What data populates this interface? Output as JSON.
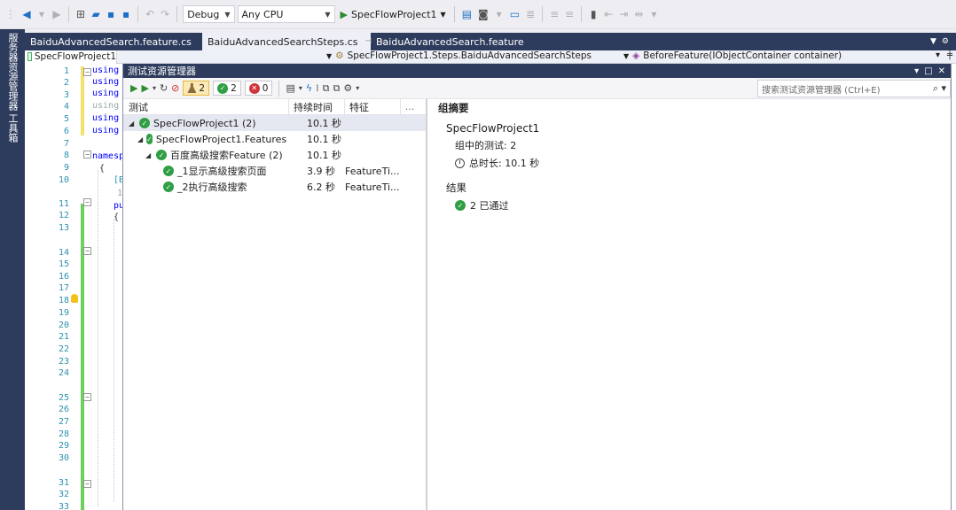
{
  "toolbar": {
    "config_dropdown": "Debug",
    "platform_dropdown": "Any CPU",
    "run_target": "SpecFlowProject1"
  },
  "side_tabs": [
    "服务器资源管理器",
    "工具箱"
  ],
  "doc_tabs": [
    {
      "label": "BaiduAdvancedSearch.feature.cs",
      "active": false
    },
    {
      "label": "BaiduAdvancedSearchSteps.cs",
      "active": true
    },
    {
      "label": "BaiduAdvancedSearch.feature",
      "active": false
    }
  ],
  "navbar": {
    "project": "SpecFlowProject1",
    "type": "SpecFlowProject1.Steps.BaiduAdvancedSearchSteps",
    "member": "BeforeFeature(IObjectContainer container)"
  },
  "editor": {
    "line_numbers": [
      "1",
      "2",
      "3",
      "4",
      "5",
      "6",
      "7",
      "8",
      "9",
      "10",
      "11",
      "12",
      "13",
      "14",
      "15",
      "16",
      "17",
      "18",
      "19",
      "20",
      "21",
      "22",
      "23",
      "24",
      "25",
      "26",
      "27",
      "28",
      "29",
      "30",
      "31",
      "32",
      "33"
    ],
    "code_lines": [
      "using",
      "using",
      "using",
      "using",
      "using",
      "using",
      "namesp",
      "{",
      "[B",
      "1",
      "pu",
      "{"
    ]
  },
  "test_explorer": {
    "title": "测试资源管理器",
    "counts": {
      "total": "2",
      "passed": "2",
      "failed": "0"
    },
    "search_placeholder": "搜索测试资源管理器 (Ctrl+E)",
    "columns": {
      "test": "测试",
      "duration": "持续时间",
      "traits": "特征",
      "more": "..."
    },
    "rows": [
      {
        "name": "SpecFlowProject1 (2)",
        "duration": "10.1 秒",
        "traits": ""
      },
      {
        "name": "SpecFlowProject1.Features ..",
        "duration": "10.1 秒",
        "traits": ""
      },
      {
        "name": "百度高级搜索Feature (2)",
        "duration": "10.1 秒",
        "traits": ""
      },
      {
        "name": "_1显示高级搜索页面",
        "duration": "3.9 秒",
        "traits": "FeatureTi..."
      },
      {
        "name": "_2执行高级搜索",
        "duration": "6.2 秒",
        "traits": "FeatureTi..."
      }
    ],
    "summary": {
      "heading": "组摘要",
      "project": "SpecFlowProject1",
      "tests_in_group": "组中的测试: 2",
      "total_duration": "总时长: 10.1 秒",
      "results_heading": "结果",
      "passed": "2 已通过"
    }
  },
  "colors": {
    "title_bar": "#2d3b5c",
    "pass": "#2f9e44",
    "fail": "#d13438",
    "gutter_changed": "#6ccf5e"
  }
}
